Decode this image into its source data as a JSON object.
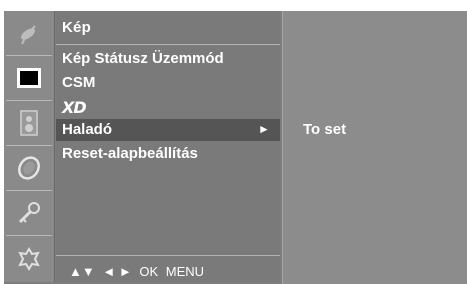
{
  "menu": {
    "title": "Kép",
    "items": [
      {
        "label": "Kép Státusz Üzemmód",
        "selected": false
      },
      {
        "label": "CSM",
        "selected": false
      },
      {
        "label": "XD",
        "selected": false,
        "logo": true
      },
      {
        "label": "Haladó",
        "selected": true,
        "arrow": "►"
      },
      {
        "label": "Reset-alapbeállítás",
        "selected": false
      }
    ]
  },
  "nav_hint": {
    "updown": "▲▼",
    "leftright": "◄ ►",
    "ok": "OK",
    "menu": "MENU"
  },
  "panel": {
    "text": "To set"
  },
  "icons": [
    "satellite-dish-icon",
    "picture-screen-icon",
    "speaker-audio-icon",
    "clock-time-icon",
    "key-lock-icon",
    "settings-option-icon"
  ],
  "colors": {
    "background": "#7d7d7d",
    "selected_row": "#555555",
    "text": "#ffffff"
  }
}
